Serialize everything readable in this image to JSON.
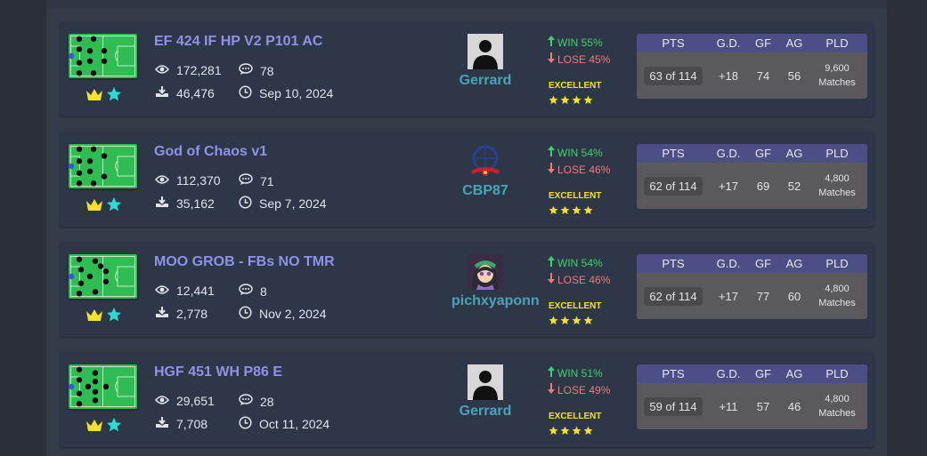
{
  "stats_headers": [
    "PTS",
    "G.D.",
    "GF",
    "AG",
    "PLD"
  ],
  "colors": {
    "title": "#8f92e6",
    "author": "#4aa4b8",
    "win": "#3fd16a",
    "lose": "#f07a7a",
    "rating": "#f3e224",
    "header_bg": "#4c4f86",
    "pitch": "#2fbc52",
    "crown": "#f5e22a",
    "star": "#2fd8d0"
  },
  "icons": [
    "eye-icon",
    "comment-icon",
    "download-icon",
    "clock-icon",
    "crown-icon",
    "star-icon",
    "arrow-up-icon",
    "arrow-down-icon"
  ],
  "cards": [
    {
      "title": "EF 424 IF HP V2 P101 AC",
      "views": "172,281",
      "comments": "78",
      "downloads": "46,476",
      "date": "Sep 10, 2024",
      "author": "Gerrard",
      "avatar": "silhouette",
      "win": "WIN 55%",
      "lose": "LOSE 45%",
      "rating": "EXCELLENT",
      "stars": 4,
      "pts": "63 of 114",
      "gd": "+18",
      "gf": "74",
      "ag": "56",
      "pld_count": "9,600",
      "pld_label": "Matches"
    },
    {
      "title": "God of Chaos v1",
      "views": "112,370",
      "comments": "71",
      "downloads": "35,162",
      "date": "Sep 7, 2024",
      "author": "CBP87",
      "avatar": "club-crest",
      "win": "WIN 54%",
      "lose": "LOSE 46%",
      "rating": "EXCELLENT",
      "stars": 4,
      "pts": "62 of 114",
      "gd": "+17",
      "gf": "69",
      "ag": "52",
      "pld_count": "4,800",
      "pld_label": "Matches"
    },
    {
      "title": "MOO GROB - FBs NO TMR",
      "views": "12,441",
      "comments": "8",
      "downloads": "2,778",
      "date": "Nov 2, 2024",
      "author": "pichxyaponn",
      "avatar": "anime-character",
      "win": "WIN 54%",
      "lose": "LOSE 46%",
      "rating": "EXCELLENT",
      "stars": 4,
      "pts": "62 of 114",
      "gd": "+17",
      "gf": "77",
      "ag": "60",
      "pld_count": "4,800",
      "pld_label": "Matches"
    },
    {
      "title": "HGF 451 WH P86 E",
      "views": "29,651",
      "comments": "28",
      "downloads": "7,708",
      "date": "Oct 11, 2024",
      "author": "Gerrard",
      "avatar": "silhouette",
      "win": "WIN 51%",
      "lose": "LOSE 49%",
      "rating": "EXCELLENT",
      "stars": 4,
      "pts": "59 of 114",
      "gd": "+11",
      "gf": "57",
      "ag": "46",
      "pld_count": "4,800",
      "pld_label": "Matches"
    }
  ]
}
